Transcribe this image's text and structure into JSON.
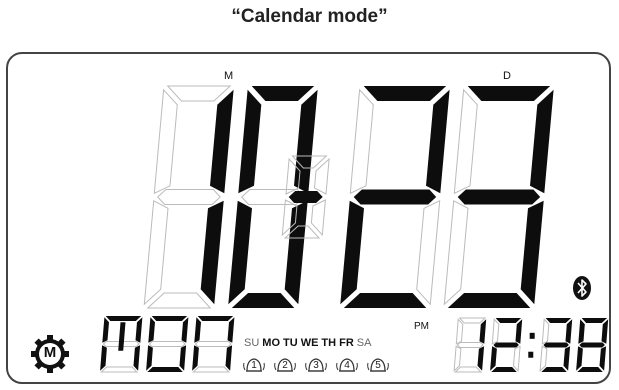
{
  "caption": "“Calendar mode”",
  "month_label": "M",
  "day_label": "D",
  "date": {
    "month": "10",
    "separator": "-",
    "day": "23"
  },
  "weekday": "MON",
  "weekdays": [
    {
      "label": "SU",
      "active": false
    },
    {
      "label": "MO",
      "active": true
    },
    {
      "label": "TU",
      "active": true
    },
    {
      "label": "WE",
      "active": true
    },
    {
      "label": "TH",
      "active": true
    },
    {
      "label": "FR",
      "active": true
    },
    {
      "label": "SA",
      "active": false
    }
  ],
  "alarms": [
    "1",
    "2",
    "3",
    "4",
    "5"
  ],
  "ampm": "PM",
  "time": {
    "hours": "12",
    "minutes": "38"
  },
  "icons": {
    "mode": "mode-m-gear-icon",
    "bluetooth": "bluetooth-icon"
  },
  "mode_letter": "M",
  "colors": {
    "segment": "#0d0d0d",
    "frame": "#444444"
  }
}
